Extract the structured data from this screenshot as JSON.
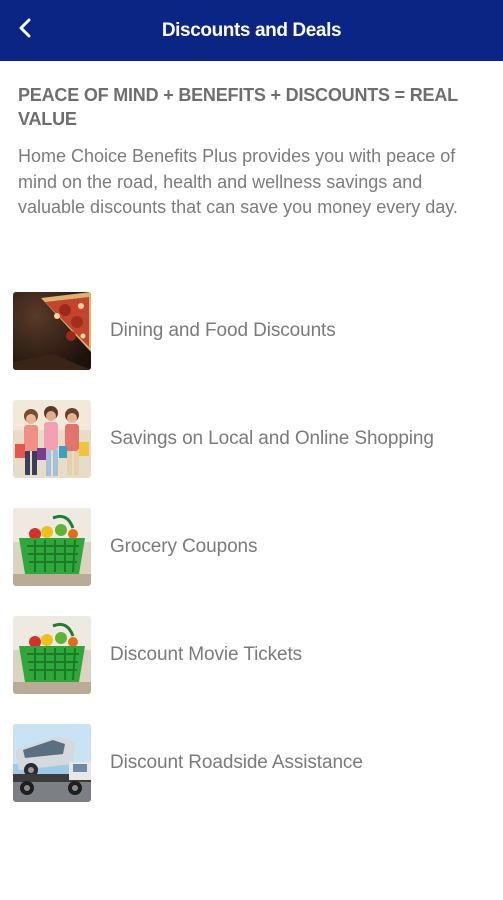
{
  "header": {
    "title": "Discounts and Deals",
    "back_icon": "chevron-left-icon"
  },
  "main": {
    "headline": "PEACE OF MIND + BENEFITS + DISCOUNTS = REAL VALUE",
    "intro": "Home Choice Benefits Plus provides you with peace of mind on the road, health and wellness savings and valuable discounts that can save you money every day."
  },
  "items": [
    {
      "label": "Dining and Food Discounts",
      "image": "pizza"
    },
    {
      "label": "Savings on Local and Online Shopping",
      "image": "shoppers"
    },
    {
      "label": "Grocery Coupons",
      "image": "grocery-basket"
    },
    {
      "label": "Discount Movie Tickets",
      "image": "grocery-basket"
    },
    {
      "label": "Discount Roadside Assistance",
      "image": "tow-truck"
    }
  ],
  "colors": {
    "header_bg": "#0b2584",
    "header_text": "#ffffff",
    "body_text": "#7b7b7b"
  }
}
